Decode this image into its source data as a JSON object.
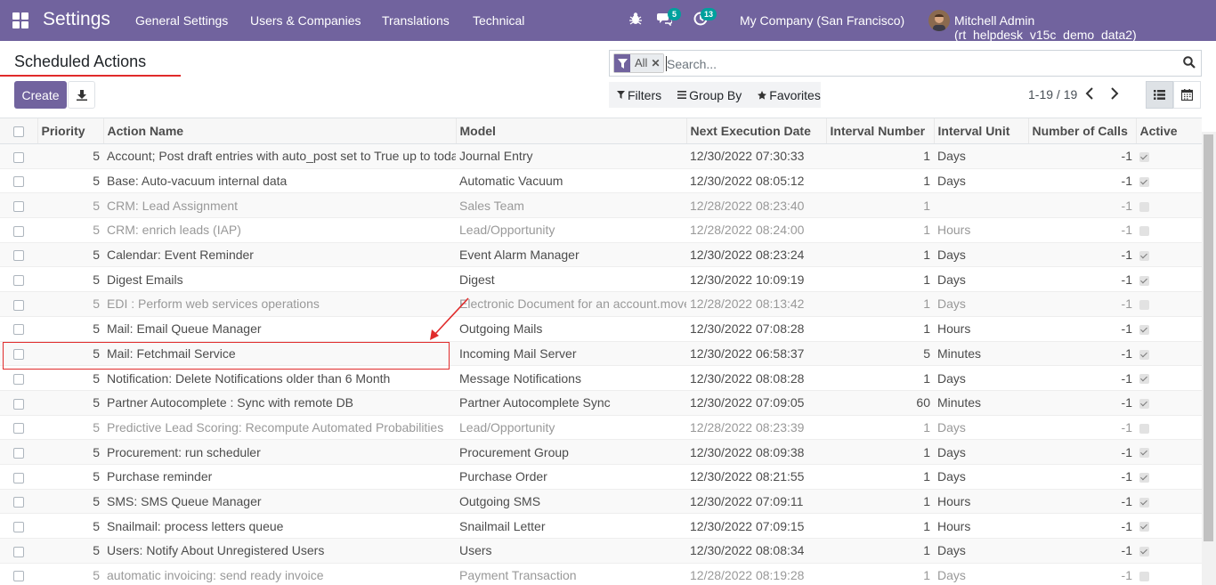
{
  "navbar": {
    "app_title": "Settings",
    "menu": [
      "General Settings",
      "Users & Companies",
      "Translations",
      "Technical"
    ],
    "messages_count": "5",
    "activities_count": "13",
    "company": "My Company (San Francisco)",
    "user": "Mitchell Admin (rt_helpdesk_v15c_demo_data2)"
  },
  "breadcrumb": "Scheduled Actions",
  "buttons": {
    "create": "Create"
  },
  "search": {
    "facet": "All",
    "placeholder": "Search..."
  },
  "filters": {
    "filters": "Filters",
    "group_by": "Group By",
    "favorites": "Favorites"
  },
  "pager": "1-19 / 19",
  "columns": [
    "Priority",
    "Action Name",
    "Model",
    "Next Execution Date",
    "Interval Number",
    "Interval Unit",
    "Number of Calls",
    "Active"
  ],
  "rows": [
    {
      "priority": "5",
      "name": "Account; Post draft entries with auto_post set to True up to today",
      "model": "Journal Entry",
      "next": "12/30/2022 07:30:33",
      "interval": "1",
      "unit": "Days",
      "calls": "-1",
      "active": true
    },
    {
      "priority": "5",
      "name": "Base: Auto-vacuum internal data",
      "model": "Automatic Vacuum",
      "next": "12/30/2022 08:05:12",
      "interval": "1",
      "unit": "Days",
      "calls": "-1",
      "active": true
    },
    {
      "priority": "5",
      "name": "CRM: Lead Assignment",
      "model": "Sales Team",
      "next": "12/28/2022 08:23:40",
      "interval": "1",
      "unit": "",
      "calls": "-1",
      "active": false
    },
    {
      "priority": "5",
      "name": "CRM: enrich leads (IAP)",
      "model": "Lead/Opportunity",
      "next": "12/28/2022 08:24:00",
      "interval": "1",
      "unit": "Hours",
      "calls": "-1",
      "active": false
    },
    {
      "priority": "5",
      "name": "Calendar: Event Reminder",
      "model": "Event Alarm Manager",
      "next": "12/30/2022 08:23:24",
      "interval": "1",
      "unit": "Days",
      "calls": "-1",
      "active": true
    },
    {
      "priority": "5",
      "name": "Digest Emails",
      "model": "Digest",
      "next": "12/30/2022 10:09:19",
      "interval": "1",
      "unit": "Days",
      "calls": "-1",
      "active": true
    },
    {
      "priority": "5",
      "name": "EDI : Perform web services operations",
      "model": "Electronic Document for an account.move",
      "next": "12/28/2022 08:13:42",
      "interval": "1",
      "unit": "Days",
      "calls": "-1",
      "active": false
    },
    {
      "priority": "5",
      "name": "Mail: Email Queue Manager",
      "model": "Outgoing Mails",
      "next": "12/30/2022 07:08:28",
      "interval": "1",
      "unit": "Hours",
      "calls": "-1",
      "active": true
    },
    {
      "priority": "5",
      "name": "Mail: Fetchmail Service",
      "model": "Incoming Mail Server",
      "next": "12/30/2022 06:58:37",
      "interval": "5",
      "unit": "Minutes",
      "calls": "-1",
      "active": true
    },
    {
      "priority": "5",
      "name": "Notification: Delete Notifications older than 6 Month",
      "model": "Message Notifications",
      "next": "12/30/2022 08:08:28",
      "interval": "1",
      "unit": "Days",
      "calls": "-1",
      "active": true
    },
    {
      "priority": "5",
      "name": "Partner Autocomplete : Sync with remote DB",
      "model": "Partner Autocomplete Sync",
      "next": "12/30/2022 07:09:05",
      "interval": "60",
      "unit": "Minutes",
      "calls": "-1",
      "active": true
    },
    {
      "priority": "5",
      "name": "Predictive Lead Scoring: Recompute Automated Probabilities",
      "model": "Lead/Opportunity",
      "next": "12/28/2022 08:23:39",
      "interval": "1",
      "unit": "Days",
      "calls": "-1",
      "active": false
    },
    {
      "priority": "5",
      "name": "Procurement: run scheduler",
      "model": "Procurement Group",
      "next": "12/30/2022 08:09:38",
      "interval": "1",
      "unit": "Days",
      "calls": "-1",
      "active": true
    },
    {
      "priority": "5",
      "name": "Purchase reminder",
      "model": "Purchase Order",
      "next": "12/30/2022 08:21:55",
      "interval": "1",
      "unit": "Days",
      "calls": "-1",
      "active": true
    },
    {
      "priority": "5",
      "name": "SMS: SMS Queue Manager",
      "model": "Outgoing SMS",
      "next": "12/30/2022 07:09:11",
      "interval": "1",
      "unit": "Hours",
      "calls": "-1",
      "active": true
    },
    {
      "priority": "5",
      "name": "Snailmail: process letters queue",
      "model": "Snailmail Letter",
      "next": "12/30/2022 07:09:15",
      "interval": "1",
      "unit": "Hours",
      "calls": "-1",
      "active": true
    },
    {
      "priority": "5",
      "name": "Users: Notify About Unregistered Users",
      "model": "Users",
      "next": "12/30/2022 08:08:34",
      "interval": "1",
      "unit": "Days",
      "calls": "-1",
      "active": true
    },
    {
      "priority": "5",
      "name": "automatic invoicing: send ready invoice",
      "model": "Payment Transaction",
      "next": "12/28/2022 08:19:28",
      "interval": "1",
      "unit": "Days",
      "calls": "-1",
      "active": false
    }
  ],
  "colors": {
    "brand": "#71639e",
    "annotation": "#e02b2b",
    "badge": "#00a09d"
  }
}
